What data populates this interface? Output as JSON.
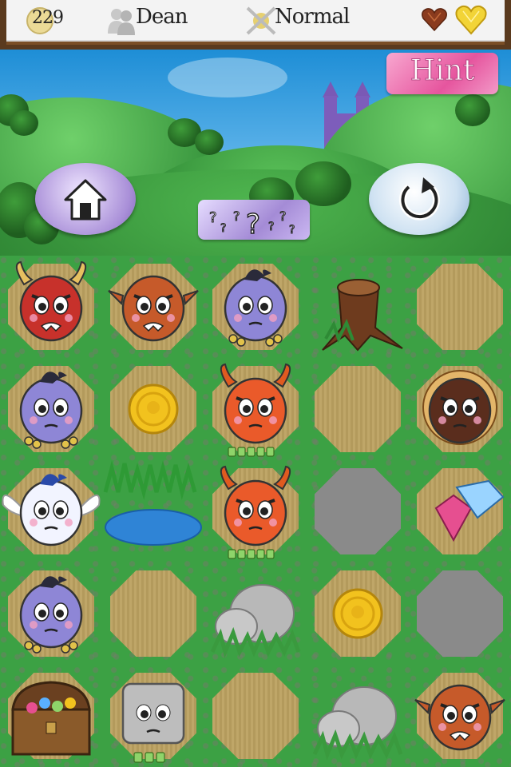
{
  "header": {
    "coins": "229",
    "player_name": "Dean",
    "difficulty": "Normal"
  },
  "buttons": {
    "hint_label": "Hint"
  },
  "board": {
    "rows": 5,
    "cols": 5,
    "cells": [
      [
        "monster-red-bull",
        "monster-orange-ogre",
        "monster-purple-troll",
        "tree-stump",
        "empty-dirt"
      ],
      [
        "monster-purple-troll",
        "gold-coin",
        "monster-orange-devil",
        "empty-dirt",
        "monster-scorpion-lion"
      ],
      [
        "monster-winged-blue",
        "pond",
        "monster-orange-devil",
        "empty-stone",
        "gems"
      ],
      [
        "monster-purple-troll",
        "empty-dirt",
        "boulder",
        "gold-coin",
        "empty-stone"
      ],
      [
        "treasure-chest",
        "monster-stone-golem",
        "empty-dirt",
        "boulder",
        "monster-orange-ogre"
      ]
    ]
  },
  "colors": {
    "grass": "#3ca144",
    "sky": "#1e8ed6",
    "hint_pink": "#f06bb0",
    "frame_wood": "#5a3a1e"
  }
}
